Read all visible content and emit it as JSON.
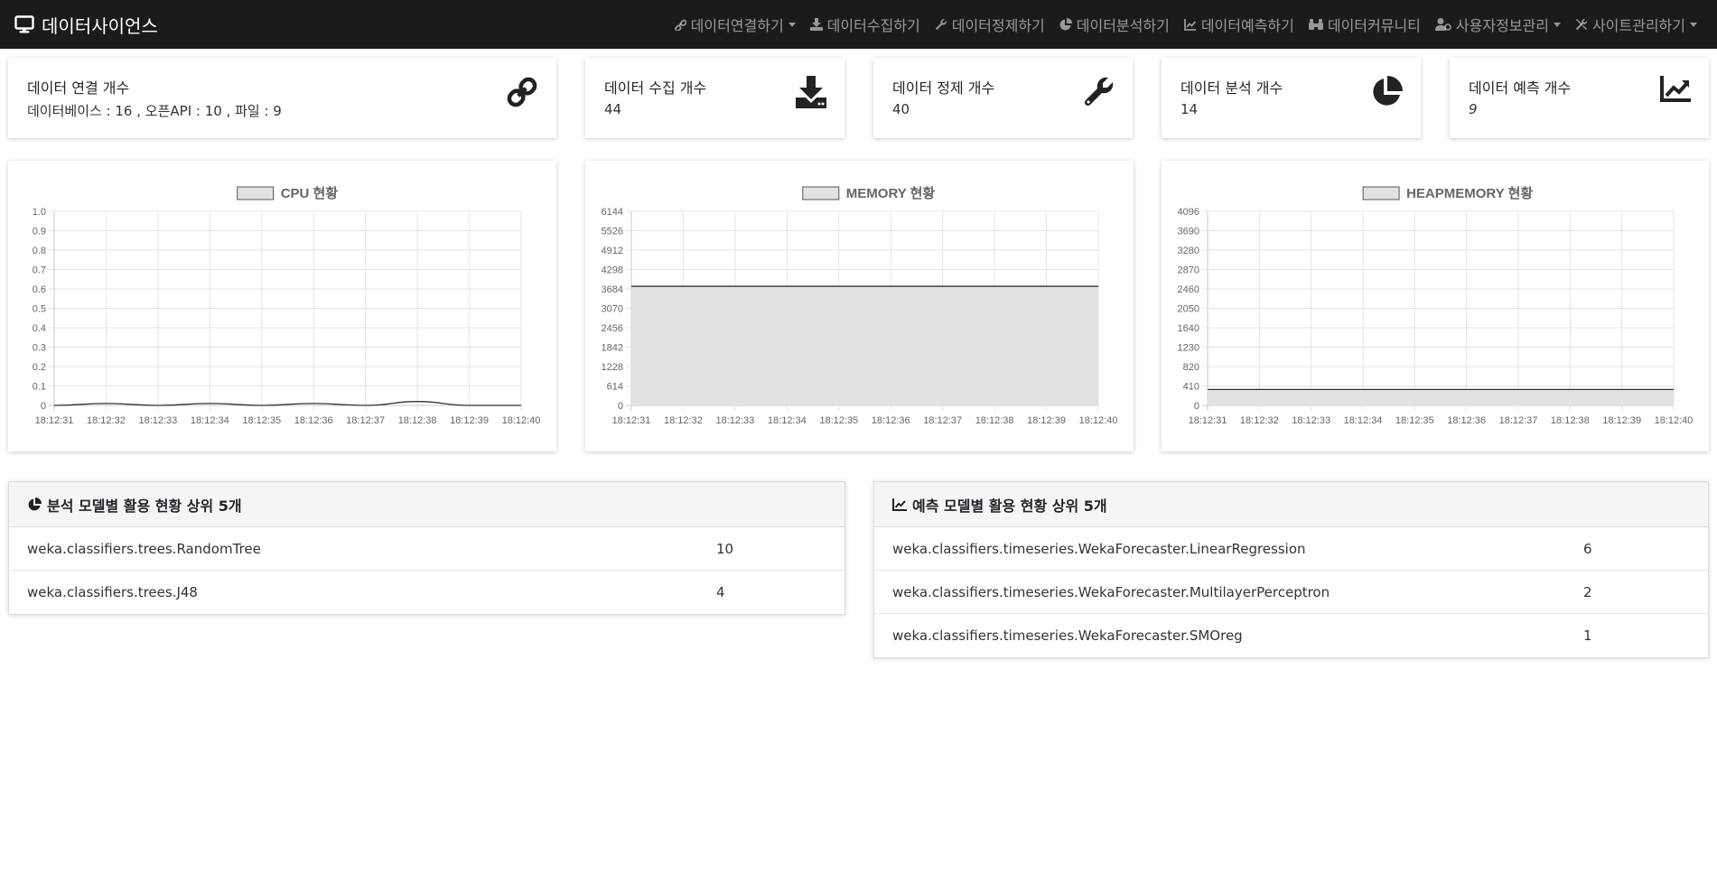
{
  "brand": {
    "title": "데이터사이언스",
    "icon": "desktop-icon"
  },
  "nav": [
    {
      "label": "데이터연결하기",
      "icon": "link-icon",
      "dropdown": true
    },
    {
      "label": "데이터수집하기",
      "icon": "download-icon",
      "dropdown": false
    },
    {
      "label": "데이터정제하기",
      "icon": "wrench-icon",
      "dropdown": false
    },
    {
      "label": "데이터분석하기",
      "icon": "pie-chart-icon",
      "dropdown": false
    },
    {
      "label": "데이터예측하기",
      "icon": "line-chart-icon",
      "dropdown": false
    },
    {
      "label": "데이터커뮤니티",
      "icon": "binoculars-icon",
      "dropdown": false
    },
    {
      "label": "사용자정보관리",
      "icon": "user-cog-icon",
      "dropdown": true
    },
    {
      "label": "사이트관리하기",
      "icon": "tools-icon",
      "dropdown": true
    }
  ],
  "stats": [
    {
      "title": "데이터 연결 개수",
      "value": "데이터베이스 : 16 , 오픈API : 10 , 파일 : 9",
      "icon": "link-icon"
    },
    {
      "title": "데이터 수집 개수",
      "value": "44",
      "icon": "download-icon"
    },
    {
      "title": "데이터 정제 개수",
      "value": "40",
      "icon": "wrench-icon"
    },
    {
      "title": "데이터 분석 개수",
      "value": "14",
      "icon": "pie-chart-icon"
    },
    {
      "title": "데이터 예측 개수",
      "value": "9",
      "icon": "line-chart-icon"
    }
  ],
  "chart_data": [
    {
      "type": "line",
      "title": "CPU 현황",
      "legend": "CPU 현황",
      "fill": false,
      "x": [
        "18:12:31",
        "18:12:32",
        "18:12:33",
        "18:12:34",
        "18:12:35",
        "18:12:36",
        "18:12:37",
        "18:12:38",
        "18:12:39",
        "18:12:40"
      ],
      "y": [
        0.0,
        0.01,
        0.0,
        0.01,
        0.0,
        0.01,
        0.0,
        0.02,
        0.0,
        0.0
      ],
      "yticks": [
        "1.0",
        "0.9",
        "0.8",
        "0.7",
        "0.6",
        "0.5",
        "0.4",
        "0.3",
        "0.2",
        "0.1",
        "0"
      ],
      "ylim": [
        0,
        1.0
      ],
      "grid": true,
      "legend_position": "top"
    },
    {
      "type": "area",
      "title": "MEMORY 현황",
      "legend": "MEMORY 현황",
      "fill": true,
      "x": [
        "18:12:31",
        "18:12:32",
        "18:12:33",
        "18:12:34",
        "18:12:35",
        "18:12:36",
        "18:12:37",
        "18:12:38",
        "18:12:39",
        "18:12:40"
      ],
      "y": [
        3770,
        3770,
        3770,
        3770,
        3770,
        3770,
        3770,
        3770,
        3770,
        3770
      ],
      "yticks": [
        "6144",
        "5526",
        "4912",
        "4298",
        "3684",
        "3070",
        "2456",
        "1842",
        "1228",
        "614",
        "0"
      ],
      "ylim": [
        0,
        6144
      ],
      "grid": true,
      "legend_position": "top"
    },
    {
      "type": "area",
      "title": "HEAPMEMORY 현황",
      "legend": "HEAPMEMORY 현황",
      "fill": true,
      "x": [
        "18:12:31",
        "18:12:32",
        "18:12:33",
        "18:12:34",
        "18:12:35",
        "18:12:36",
        "18:12:37",
        "18:12:38",
        "18:12:39",
        "18:12:40"
      ],
      "y": [
        336,
        336,
        336,
        336,
        336,
        336,
        336,
        336,
        336,
        336
      ],
      "yticks": [
        "4096",
        "3690",
        "3280",
        "2870",
        "2460",
        "2050",
        "1640",
        "1230",
        "820",
        "410",
        "0"
      ],
      "ylim": [
        0,
        4096
      ],
      "grid": true,
      "legend_position": "top"
    }
  ],
  "analysis_panel": {
    "title": "분석 모델별 활용 현황 상위 5개",
    "icon": "pie-chart-icon",
    "rows": [
      {
        "name": "weka.classifiers.trees.RandomTree",
        "count": "10"
      },
      {
        "name": "weka.classifiers.trees.J48",
        "count": "4"
      }
    ]
  },
  "forecast_panel": {
    "title": "예측 모델별 활용 현황 상위 5개",
    "icon": "line-chart-icon",
    "rows": [
      {
        "name": "weka.classifiers.timeseries.WekaForecaster.LinearRegression",
        "count": "6"
      },
      {
        "name": "weka.classifiers.timeseries.WekaForecaster.MultilayerPerceptron",
        "count": "2"
      },
      {
        "name": "weka.classifiers.timeseries.WekaForecaster.SMOreg",
        "count": "1"
      }
    ]
  },
  "colors": {
    "navbar": "#1b1b1b",
    "nav_text": "#9a9a9a",
    "chart_fill": "#e2e2e2",
    "chart_line": "#333333"
  }
}
